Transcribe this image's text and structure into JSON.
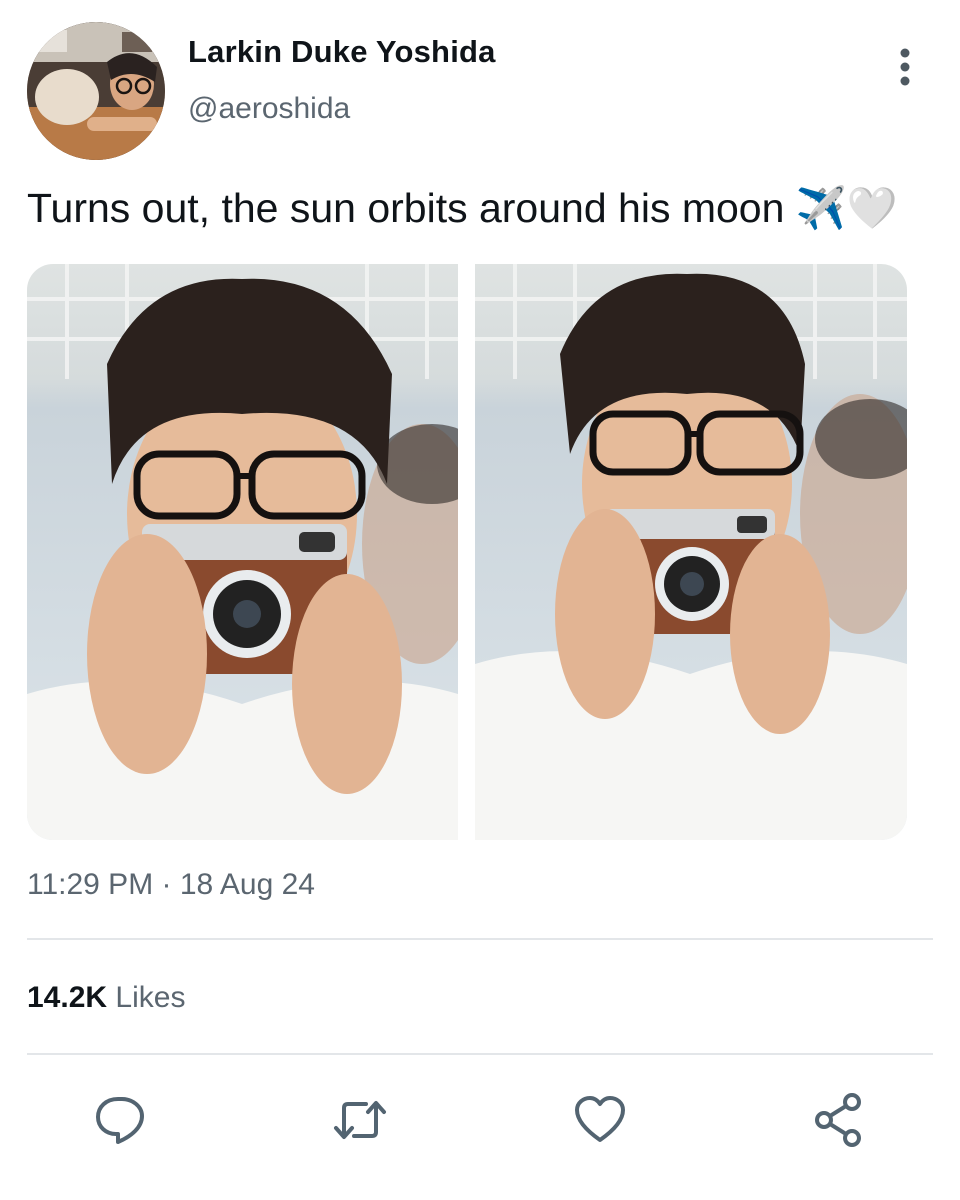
{
  "tweet": {
    "author": {
      "display_name": "Larkin Duke Yoshida",
      "handle": "@aeroshida",
      "avatar_icon": "profile-photo"
    },
    "text": "Turns out, the sun orbits around his moon ",
    "emoji": "✈️🤍",
    "timestamp": "11:29 PM · 18 Aug 24",
    "likes": {
      "count": "14.2K",
      "label": "Likes"
    }
  },
  "menu_icon": "more-vertical-icon",
  "actions": [
    {
      "icon": "reply-icon"
    },
    {
      "icon": "retweet-icon"
    },
    {
      "icon": "like-icon"
    },
    {
      "icon": "share-icon"
    }
  ],
  "colors": {
    "text": "#0f1419",
    "secondary": "#5b6670",
    "divider": "#e3e6e9",
    "icon": "#536471"
  }
}
